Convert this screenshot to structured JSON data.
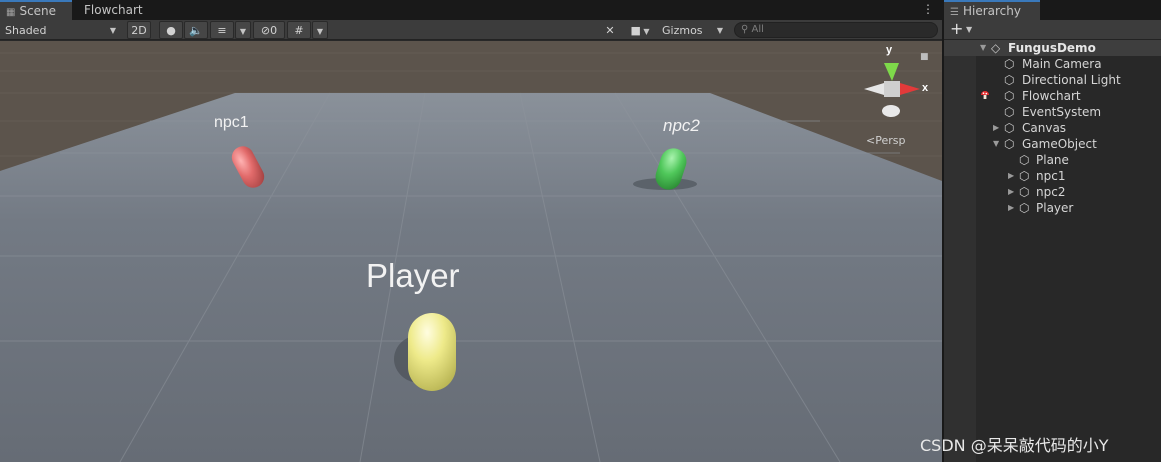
{
  "scene_panel": {
    "tabs": [
      {
        "label": "Scene",
        "icon": "grid-icon",
        "active": true
      },
      {
        "label": "Flowchart",
        "active": false
      }
    ],
    "toolbar": {
      "shading_mode": "Shaded",
      "mode_2d": "2D",
      "hidden_count": "0",
      "gizmos_label": "Gizmos",
      "search_placeholder": "All"
    },
    "viewport": {
      "labels": {
        "npc1": "npc1",
        "npc2": "npc2",
        "player": "Player"
      },
      "projection_label": "Persp",
      "axis_labels": {
        "y": "y",
        "x": "x"
      },
      "colors": {
        "npc1": "#e26b6b",
        "npc2": "#4fc75a",
        "player": "#eeea8a",
        "ground": "#6d747e",
        "backdrop": "#5a524a"
      }
    }
  },
  "hierarchy_panel": {
    "tab_label": "Hierarchy",
    "items": [
      {
        "label": "FungusDemo",
        "type": "scene",
        "expanded": true
      },
      {
        "label": "Main Camera",
        "depth": 1
      },
      {
        "label": "Directional Light",
        "depth": 1
      },
      {
        "label": "Flowchart",
        "depth": 1,
        "marker": "mushroom-icon"
      },
      {
        "label": "EventSystem",
        "depth": 1
      },
      {
        "label": "Canvas",
        "depth": 1,
        "collapsed": true
      },
      {
        "label": "GameObject",
        "depth": 1,
        "expanded": true
      },
      {
        "label": "Plane",
        "depth": 2
      },
      {
        "label": "npc1",
        "depth": 2,
        "collapsed": true
      },
      {
        "label": "npc2",
        "depth": 2,
        "collapsed": true
      },
      {
        "label": "Player",
        "depth": 2,
        "collapsed": true
      }
    ]
  },
  "watermark": "CSDN @呆呆敲代码的小Y"
}
